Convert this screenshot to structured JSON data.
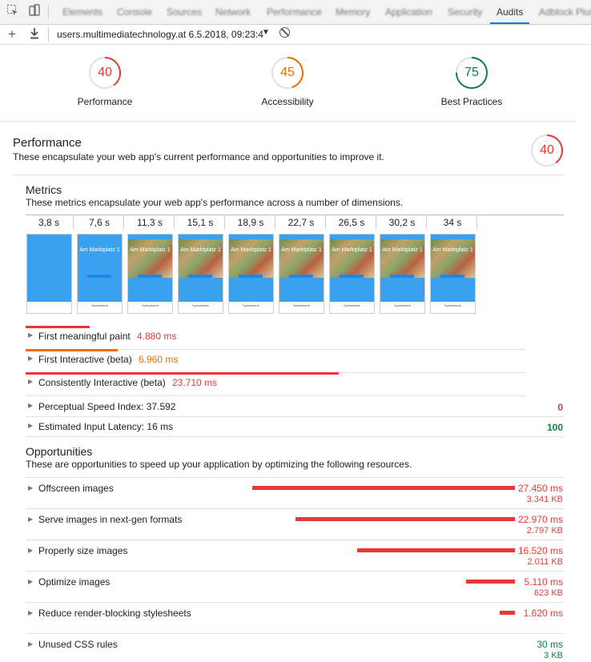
{
  "devtools": {
    "tabs": [
      "Elements",
      "Console",
      "Sources",
      "Network",
      "Performance",
      "Memory",
      "Application",
      "Security",
      "Audits",
      "Adblock Plus"
    ],
    "active_tab": "Audits",
    "report_label": "users.multimediatechnology.at 6.5.2018, 09:23:4",
    "accent": "#1a73e8"
  },
  "gauges": [
    {
      "label": "Performance",
      "score": "40",
      "color": "#e53935",
      "fraction": 0.4
    },
    {
      "label": "Accessibility",
      "score": "45",
      "color": "#ef6c00",
      "fraction": 0.45
    },
    {
      "label": "Best Practices",
      "score": "75",
      "color": "#0b8043",
      "fraction": 0.75
    }
  ],
  "performance": {
    "title": "Performance",
    "description": "These encapsulate your web app's current performance and opportunities to improve it.",
    "score": "40",
    "color": "#e53935",
    "fraction": 0.4
  },
  "metrics": {
    "title": "Metrics",
    "description": "These metrics encapsulate your web app's performance across a number of dimensions.",
    "filmstrip_times": [
      "3,8 s",
      "7,6 s",
      "11,3 s",
      "15,1 s",
      "18,9 s",
      "22,7 s",
      "26,5 s",
      "30,2 s",
      "34 s"
    ],
    "frame_title": "Am Marktplatz 1",
    "frame_footer": "Speisekarte",
    "rows": [
      {
        "label": "First meaningful paint",
        "value": "4.880 ms",
        "color": "red"
      },
      {
        "label": "First Interactive (beta)",
        "value": "6.960 ms",
        "color": "orange"
      },
      {
        "label": "Consistently Interactive (beta)",
        "value": "23.710 ms",
        "color": "red"
      }
    ],
    "score_rows": [
      {
        "label": "Perceptual Speed Index: 37.592",
        "score": "0",
        "color": "red"
      },
      {
        "label": "Estimated Input Latency: 16 ms",
        "score": "100",
        "color": "green"
      }
    ]
  },
  "opportunities": {
    "title": "Opportunities",
    "description": "These are opportunities to speed up your application by optimizing the following resources.",
    "items": [
      {
        "label": "Offscreen images",
        "time": "27.450 ms",
        "size": "3.341 KB",
        "color": "red"
      },
      {
        "label": "Serve images in next-gen formats",
        "time": "22.970 ms",
        "size": "2.797 KB",
        "color": "red"
      },
      {
        "label": "Properly size images",
        "time": "16.520 ms",
        "size": "2.011 KB",
        "color": "red"
      },
      {
        "label": "Optimize images",
        "time": "5.110 ms",
        "size": "623 KB",
        "color": "red"
      },
      {
        "label": "Reduce render-blocking stylesheets",
        "time": "1.620 ms",
        "size": "",
        "color": "red"
      },
      {
        "label": "Unused CSS rules",
        "time": "30 ms",
        "size": "3 KB",
        "color": "green"
      }
    ]
  }
}
